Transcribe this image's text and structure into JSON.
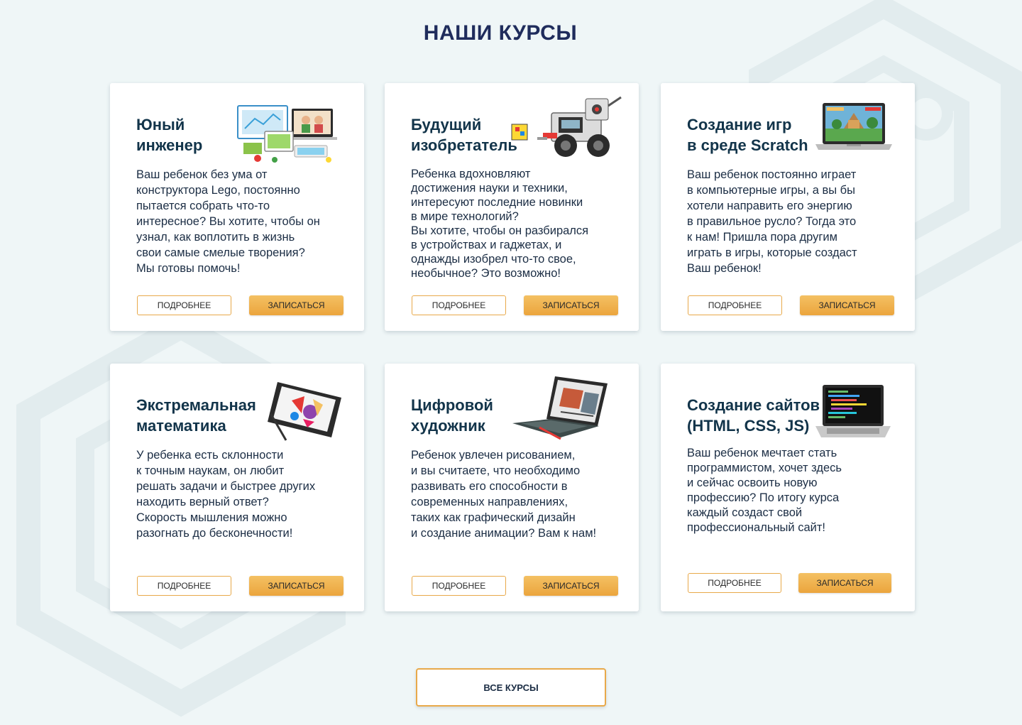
{
  "section": {
    "title": "НАШИ КУРСЫ"
  },
  "courses": [
    {
      "title": "Юный\nинженер",
      "description": "Ваш ребенок без ума от\nконструктора Lego, постоянно\nпытается собрать что-то\nинтересное? Вы хотите, чтобы он\nузнал, как воплотить в жизнь\nсвои самые смелые творения?\nМы готовы помочь!",
      "image_icon": "lego-kit-icon",
      "more_label": "ПОДРОБНЕЕ",
      "signup_label": "ЗАПИСАТЬСЯ"
    },
    {
      "title": "Будущий\nизобретатель",
      "description": "Ребенка вдохновляют\nдостижения науки и техники,\nинтересуют последние новинки\nв мире технологий?\nВы хотите, чтобы он разбирался\nв устройствах и гаджетах, и\nоднажды изобрел что-то свое,\nнеобычное? Это возможно!",
      "image_icon": "robot-icon",
      "more_label": "ПОДРОБНЕЕ",
      "signup_label": "ЗАПИСАТЬСЯ"
    },
    {
      "title": "Создание игр\nв среде Scratch",
      "description": "Ваш ребенок постоянно играет\nв компьютерные игры, а вы бы\nхотели направить его энергию\nв правильное русло? Тогда это\nк нам! Пришла пора другим\nиграть в игры, которые создаст\nВаш ребенок!",
      "image_icon": "laptop-game-icon",
      "more_label": "ПОДРОБНЕЕ",
      "signup_label": "ЗАПИСАТЬСЯ"
    },
    {
      "title": "Экстремальная\nматематика",
      "description": "У ребенка есть склонности\nк точным наукам, он любит\nрешать задачи и быстрее других\nнаходить верный ответ?\nСкорость мышления можно\nразогнать до бесконечности!",
      "image_icon": "graphics-tablet-icon",
      "more_label": "ПОДРОБНЕЕ",
      "signup_label": "ЗАПИСАТЬСЯ"
    },
    {
      "title": "Цифровой\nхудожник",
      "description": "Ребенок увлечен рисованием,\nи вы считаете, что необходимо\nразвивать его способности в\nсовременных направлениях,\nтаких как графический дизайн\nи создание анимации? Вам к нам!",
      "image_icon": "drawing-laptop-icon",
      "more_label": "ПОДРОБНЕЕ",
      "signup_label": "ЗАПИСАТЬСЯ"
    },
    {
      "title": "Создание сайтов\n(HTML, CSS, JS)",
      "description": "Ваш ребенок мечтает стать\nпрограммистом, хочет здесь\nи сейчас освоить новую\nпрофессию? По итогу курса\nкаждый создаст свой\nпрофессиональный сайт!",
      "image_icon": "code-laptop-icon",
      "more_label": "ПОДРОБНЕЕ",
      "signup_label": "ЗАПИСАТЬСЯ"
    }
  ],
  "all_courses_label": "ВСЕ КУРСЫ",
  "colors": {
    "background": "#eff6f7",
    "title": "#1f2c5c",
    "accent": "#eba53d",
    "card": "#ffffff"
  }
}
